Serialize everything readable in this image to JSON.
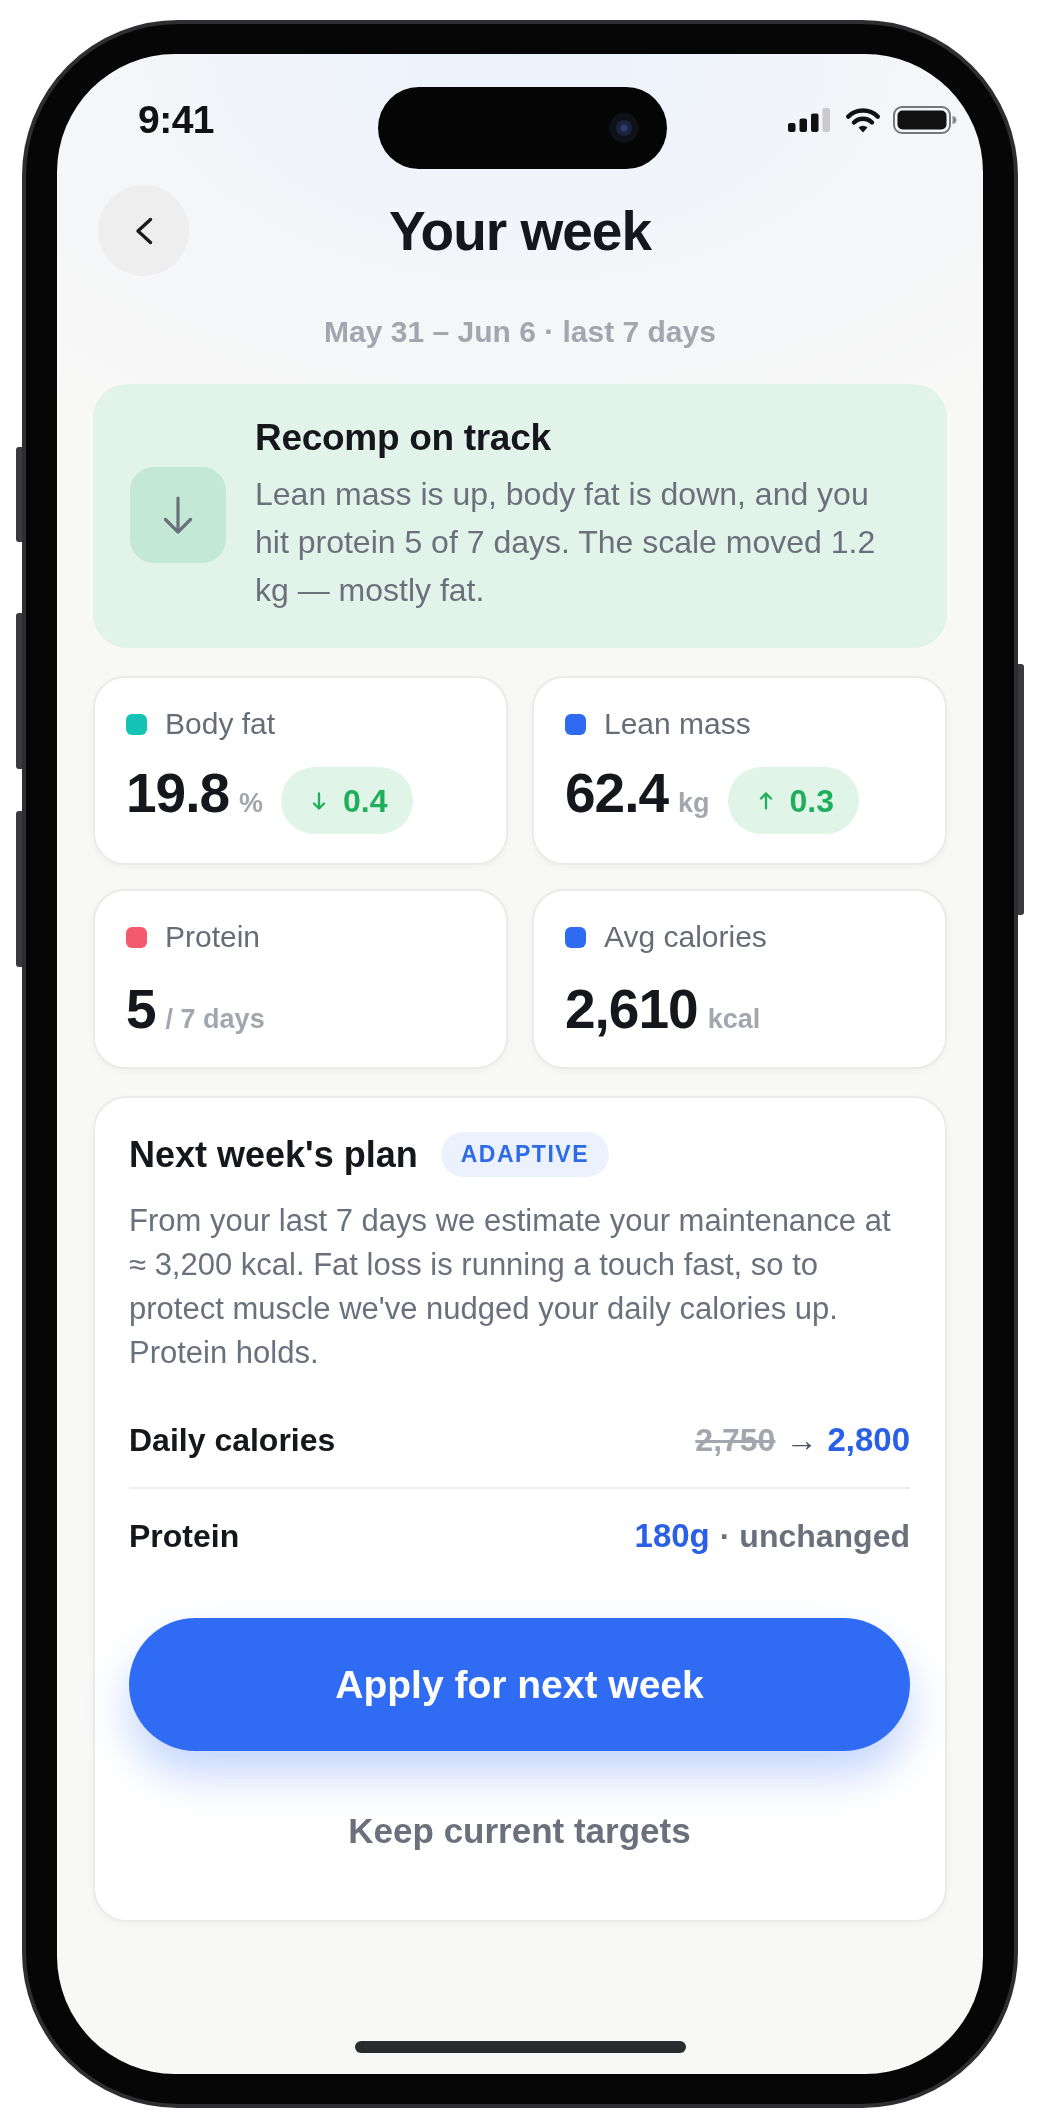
{
  "status_bar": {
    "time": "9:41"
  },
  "header": {
    "title": "Your week",
    "subtitle": "May 31 – Jun 6 · last 7 days"
  },
  "summary": {
    "title": "Recomp on track",
    "text": "Lean mass is up, body fat is down, and you hit protein 5 of 7 days. The scale moved 1.2 kg — mostly fat."
  },
  "stats": [
    {
      "label": "Body fat",
      "color": "#15c3b4",
      "value": "19.8",
      "unit": "%",
      "change": {
        "up": false,
        "value": "0.4"
      }
    },
    {
      "label": "Lean mass",
      "color": "#2f6bf0",
      "value": "62.4",
      "unit": "kg",
      "change": {
        "up": true,
        "value": "0.3"
      }
    },
    {
      "label": "Protein",
      "color": "#f45a6d",
      "value": "5",
      "unit": "/ 7 days"
    },
    {
      "label": "Avg calories",
      "color": "#2f6bf0",
      "value": "2,610",
      "unit": "kcal"
    }
  ],
  "plan": {
    "title": "Next week's plan",
    "badge": "ADAPTIVE",
    "text": "From your last 7 days we estimate your maintenance at ≈ 3,200 kcal. Fat loss is running a touch fast, so to protect muscle we've nudged your daily calories up. Protein holds.",
    "rows": [
      {
        "kind": "change",
        "label": "Daily calories",
        "old": "2,750",
        "arrow": "→",
        "new": "2,800"
      },
      {
        "kind": "hold",
        "label": "Protein",
        "value": "180g",
        "note": "· unchanged"
      }
    ],
    "primary_button": "Apply for next week",
    "secondary_button": "Keep current targets"
  }
}
